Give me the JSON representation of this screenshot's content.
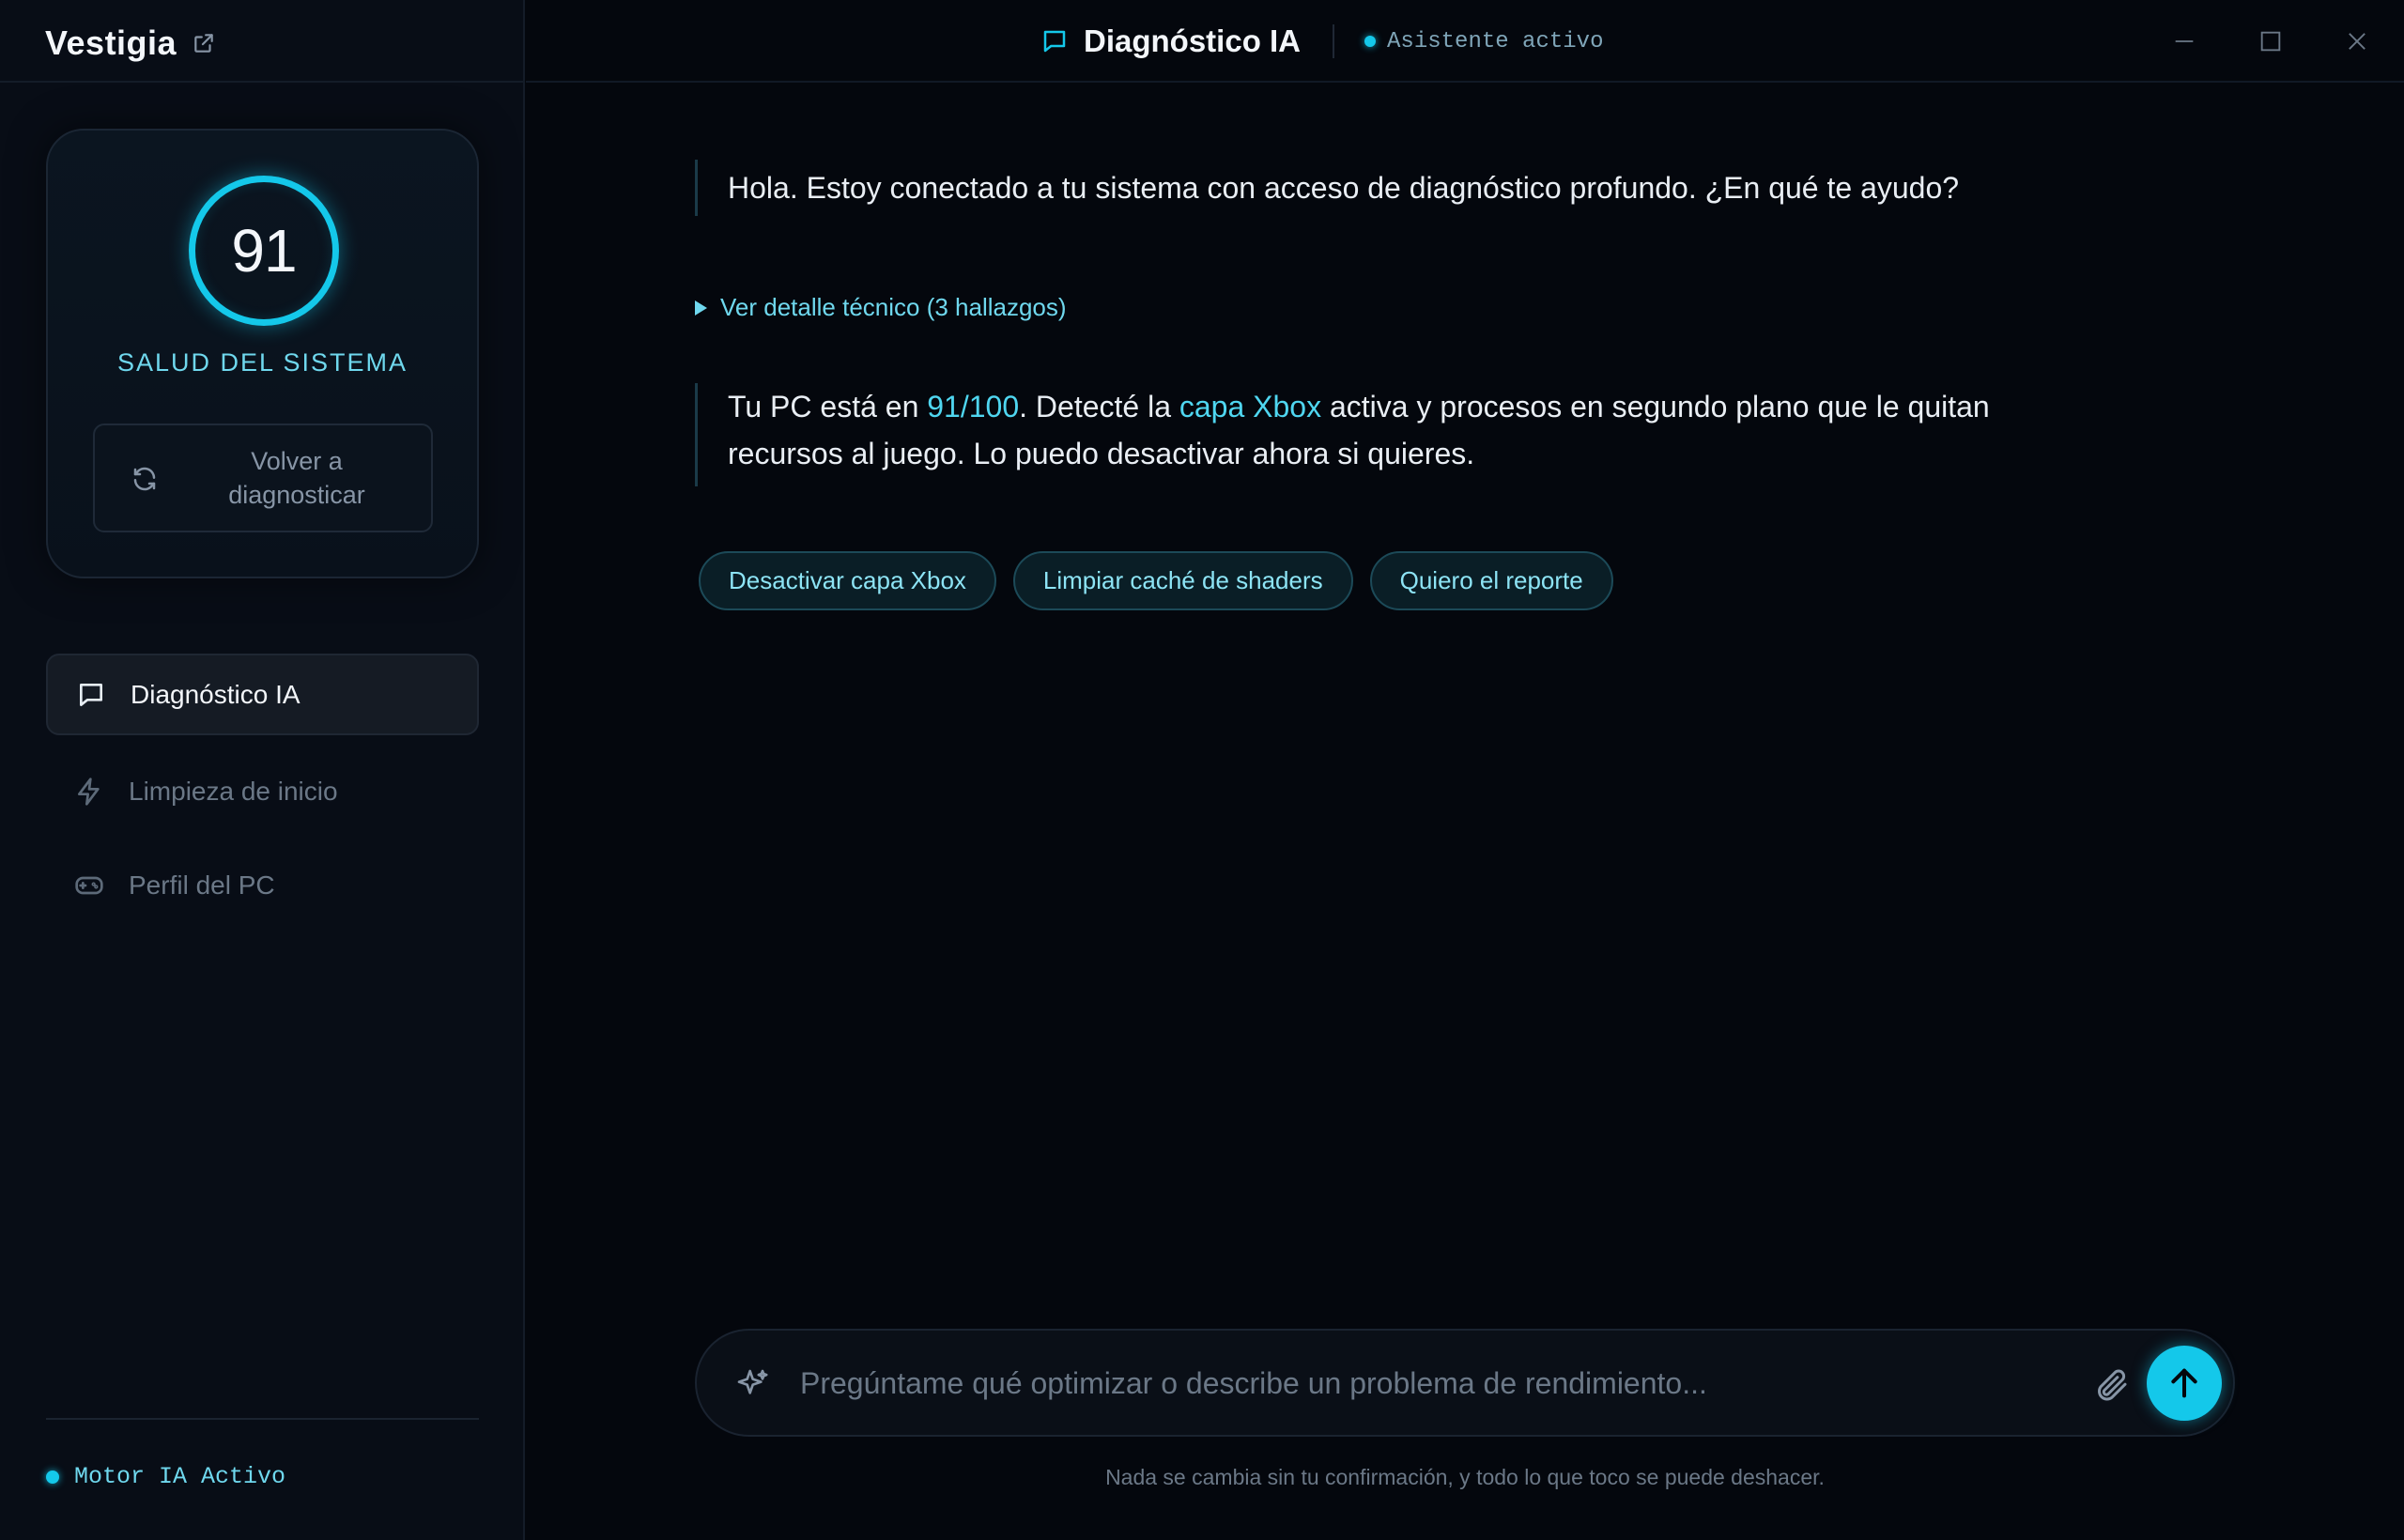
{
  "app": {
    "name": "Vestigia"
  },
  "header": {
    "title": "Diagnóstico IA",
    "status": "Asistente activo"
  },
  "health": {
    "score": "91",
    "label": "SALUD DEL SISTEMA",
    "rediagnose_label": "Volver a diagnosticar"
  },
  "nav": {
    "items": [
      {
        "label": "Diagnóstico IA",
        "icon": "chat-icon",
        "active": true
      },
      {
        "label": "Limpieza de inicio",
        "icon": "lightning-icon",
        "active": false
      },
      {
        "label": "Perfil del PC",
        "icon": "gamepad-icon",
        "active": false
      }
    ]
  },
  "engine_status": "Motor IA Activo",
  "chat": {
    "greeting": "Hola. Estoy conectado a tu sistema con acceso de diagnóstico profundo. ¿En qué te ayudo?",
    "details_toggle": "Ver detalle técnico (3 hallazgos)",
    "reply": {
      "part1": "Tu PC está en ",
      "score": "91/100",
      "part2": ". Detecté la ",
      "highlight": "capa Xbox",
      "part3": " activa y procesos en segundo plano que le quitan recursos al juego. Lo puedo desactivar ahora si quieres."
    },
    "actions": [
      "Desactivar capa Xbox",
      "Limpiar caché de shaders",
      "Quiero el reporte"
    ]
  },
  "input": {
    "placeholder": "Pregúntame qué optimizar o describe un problema de rendimiento...",
    "value": ""
  },
  "footnote": "Nada se cambia sin tu confirmación, y todo lo que toco se puede deshacer.",
  "colors": {
    "accent": "#14c8ea",
    "accent_text": "#4fd6f0",
    "background": "#04070d",
    "sidebar": "#080d16"
  }
}
